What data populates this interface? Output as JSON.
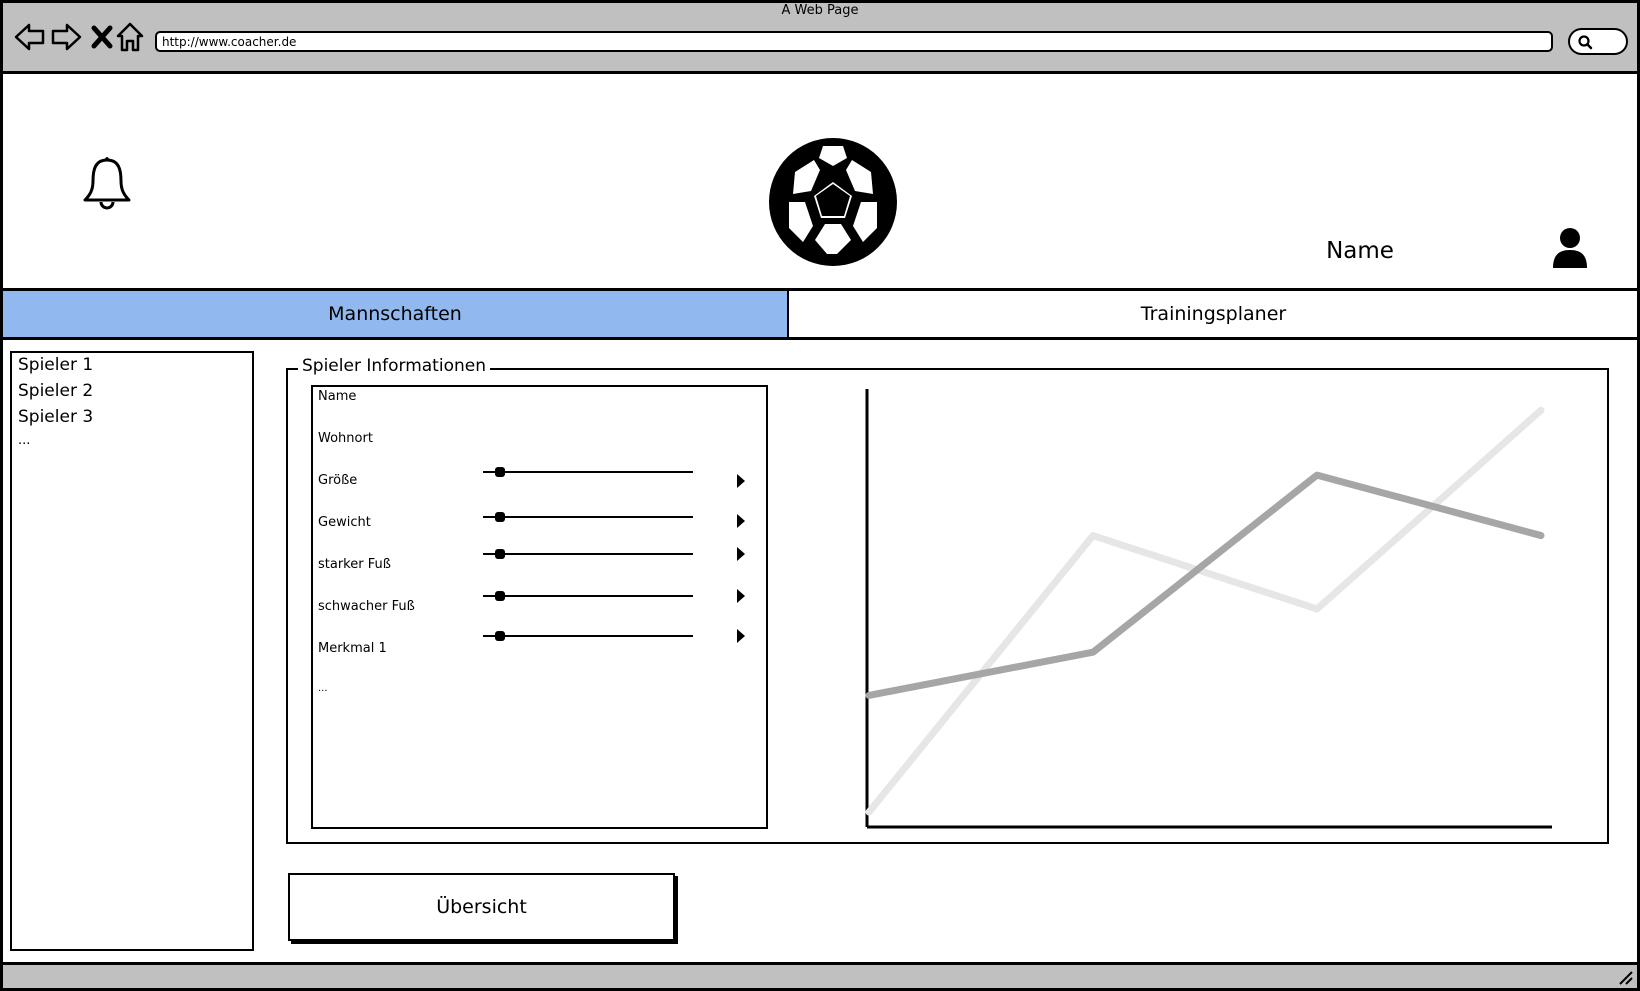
{
  "browser": {
    "window_title": "A Web Page",
    "url": "http://www.coacher.de"
  },
  "icons": {
    "back": "back-arrow-icon",
    "forward": "forward-arrow-icon",
    "stop": "close-icon",
    "home": "home-icon",
    "search": "search-icon",
    "notifications": "bell-icon",
    "logo": "soccer-ball-icon",
    "user": "user-icon"
  },
  "header": {
    "user_name": "Name"
  },
  "tabs": [
    {
      "label": "Mannschaften",
      "active": true,
      "color": "#91b9ef"
    },
    {
      "label": "Trainingsplaner",
      "active": false
    }
  ],
  "players": [
    "Spieler 1",
    "Spieler 2",
    "Spieler 3",
    "..."
  ],
  "info": {
    "legend": "Spieler Informationen",
    "fields": [
      {
        "label": "Name"
      },
      {
        "label": "Wohnort"
      },
      {
        "label": "Größe",
        "slider": 0.08
      },
      {
        "label": "Gewicht",
        "slider": 0.08
      },
      {
        "label": "starker Fuß",
        "slider": 0.08
      },
      {
        "label": "schwacher Fuß",
        "slider": 0.08
      },
      {
        "label": "Merkmal 1",
        "slider": 0.08
      },
      {
        "label": "..."
      }
    ]
  },
  "chart_data": {
    "type": "line",
    "title": "",
    "xlabel": "",
    "ylabel": "",
    "x": [
      0,
      1,
      2,
      3
    ],
    "ylim": [
      0,
      100
    ],
    "grid": false,
    "series": [
      {
        "values": [
          3,
          67,
          50,
          96
        ],
        "color": "#e6e6e6"
      },
      {
        "values": [
          30,
          40,
          81,
          67
        ],
        "color": "#a6a6a6"
      }
    ]
  },
  "actions": {
    "overview_label": "Übersicht"
  }
}
